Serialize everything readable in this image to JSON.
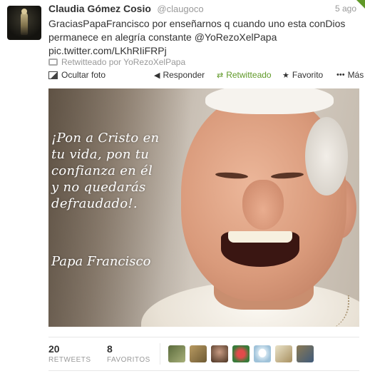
{
  "tweet": {
    "fullname": "Claudia Gómez Cosio",
    "username": "@claugoco",
    "timestamp": "5 ago",
    "text_line1": "GraciasPapaFrancisco por enseñarnos q cuando uno esta conDios",
    "text_line2": "permanece en alegría constante @YoRezoXelPapa",
    "text_line3": "pic.twitter.com/LKhRIiFRPj",
    "retweeted_by": "Retwitteado por YoRezoXelPapa"
  },
  "actions": {
    "hide_photo": "Ocultar foto",
    "reply": "Responder",
    "retweeted": "Retwitteado",
    "favorite": "Favorito",
    "more": "Más"
  },
  "photo": {
    "quote_lines": [
      "¡Pon a Cristo en",
      "tu vida, pon tu",
      "confianza en él",
      "y no quedarás",
      "defraudado!."
    ],
    "author": "Papa Francisco"
  },
  "stats": {
    "retweets_count": "20",
    "retweets_label": "RETWEETS",
    "favorites_count": "8",
    "favorites_label": "FAVORITOS"
  },
  "colors": {
    "retweeted_green": "#609928",
    "text": "#333333",
    "muted": "#999999"
  },
  "icons": {
    "photo": "photo-icon",
    "reply": "reply-icon",
    "retweet": "retweet-icon",
    "favorite": "star-icon",
    "more": "more-dots-icon"
  }
}
